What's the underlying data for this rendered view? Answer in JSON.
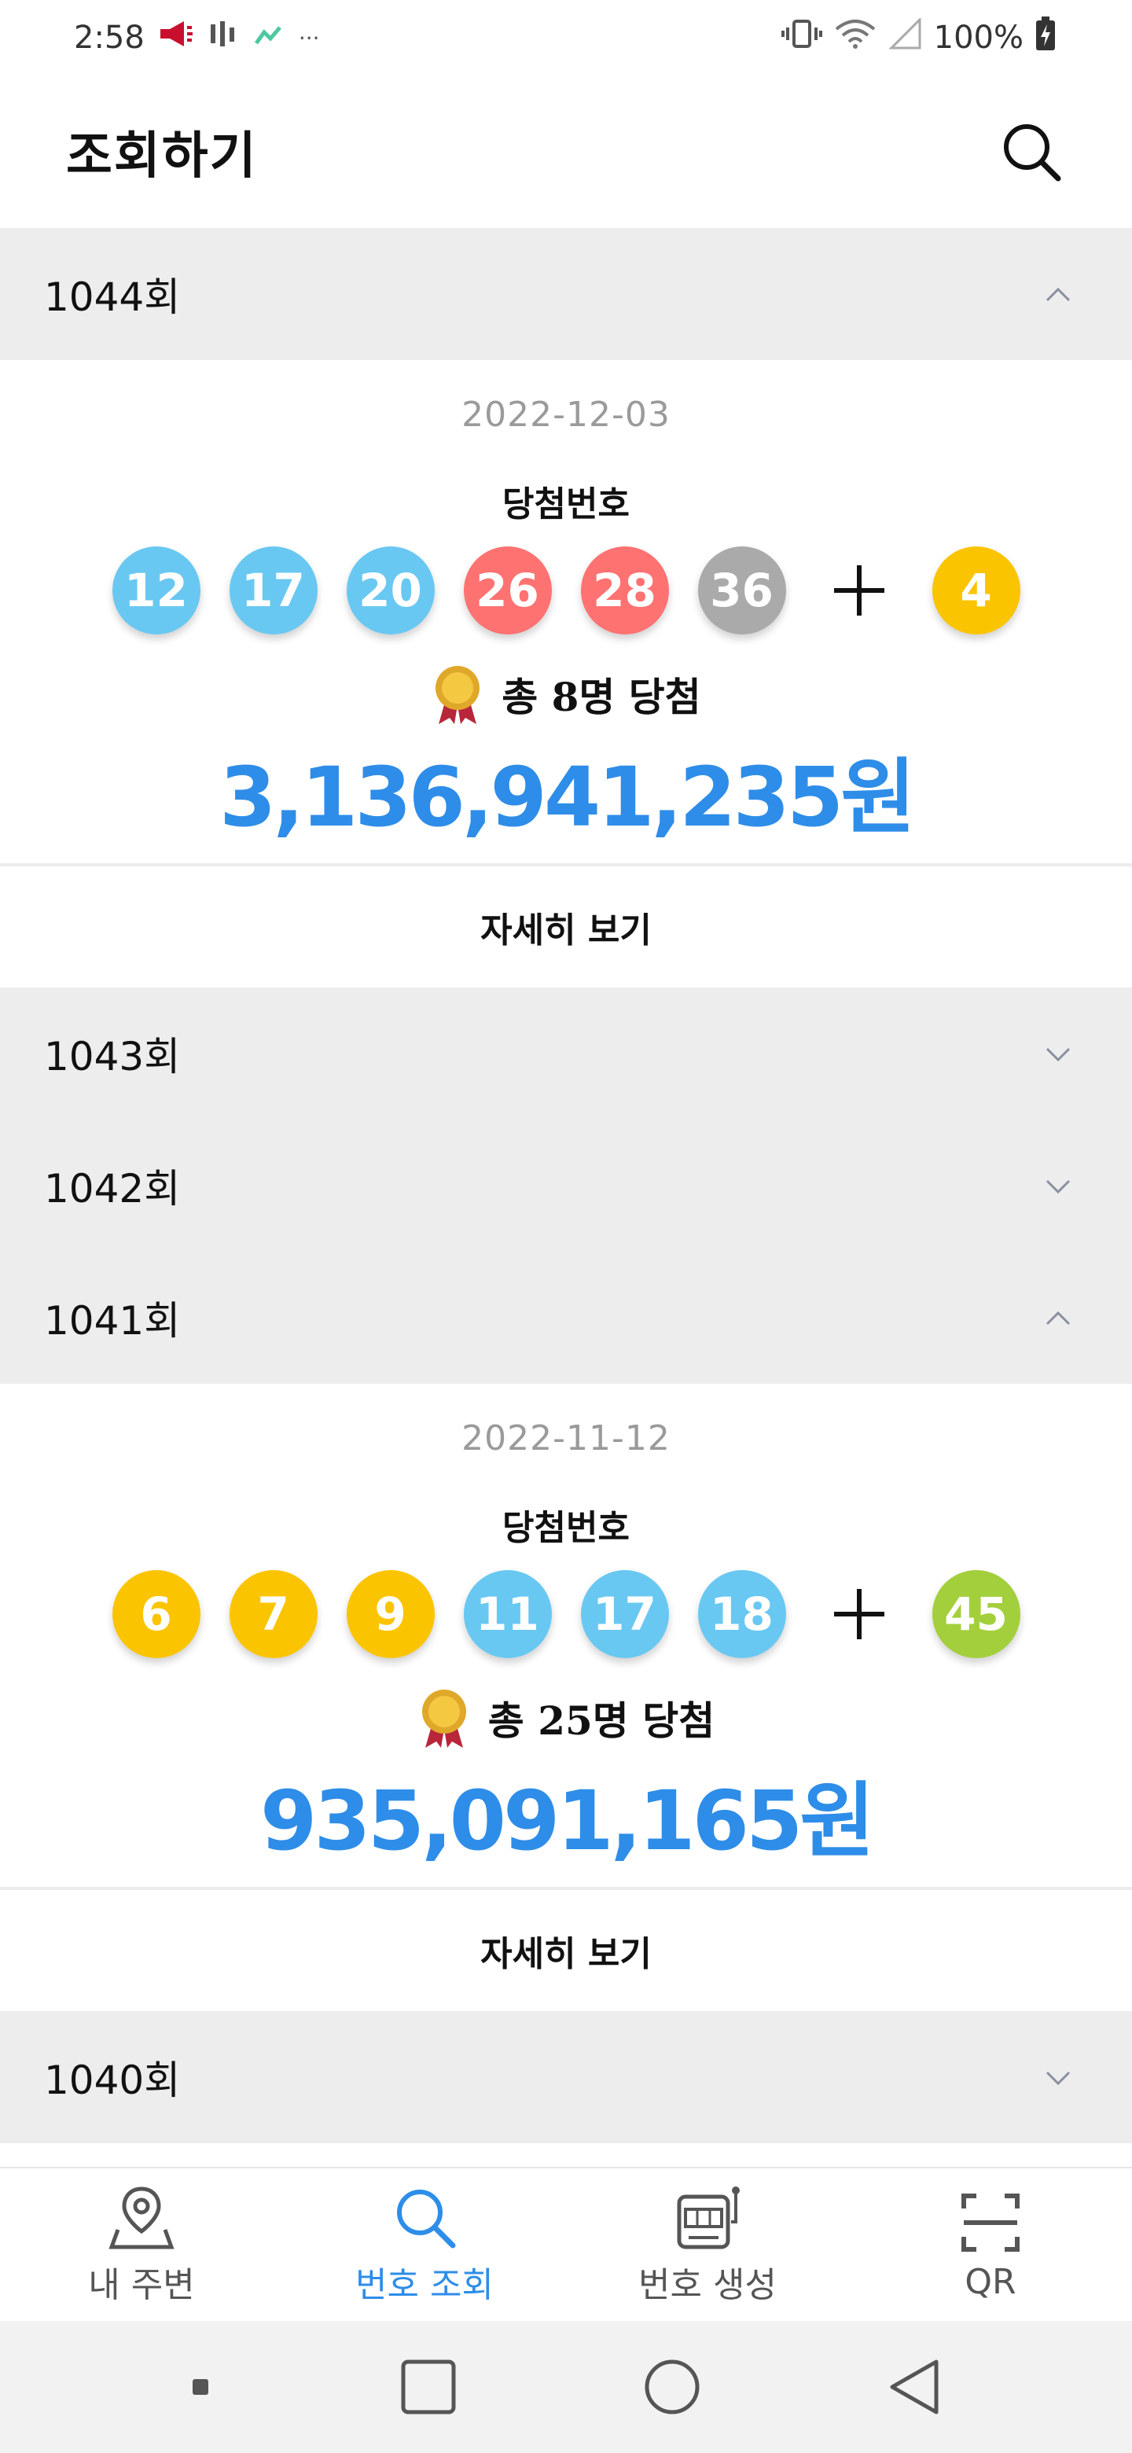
{
  "status_bar": {
    "time": "2:58",
    "battery": "100%"
  },
  "app_bar": {
    "title": "조회하기"
  },
  "rounds": [
    {
      "label": "1044회",
      "expanded": true,
      "date": "2022-12-03",
      "win_label": "당첨번호",
      "numbers": [
        {
          "n": "12",
          "color": "#69c8f2"
        },
        {
          "n": "17",
          "color": "#69c8f2"
        },
        {
          "n": "20",
          "color": "#69c8f2"
        },
        {
          "n": "26",
          "color": "#ff7272"
        },
        {
          "n": "28",
          "color": "#ff7272"
        },
        {
          "n": "36",
          "color": "#aaaaaa"
        }
      ],
      "bonus": {
        "n": "4",
        "color": "#fbc400"
      },
      "winners": "총 8명 당첨",
      "prize": "3,136,941,235원",
      "more": "자세히 보기"
    },
    {
      "label": "1043회",
      "expanded": false
    },
    {
      "label": "1042회",
      "expanded": false
    },
    {
      "label": "1041회",
      "expanded": true,
      "date": "2022-11-12",
      "win_label": "당첨번호",
      "numbers": [
        {
          "n": "6",
          "color": "#fbc400"
        },
        {
          "n": "7",
          "color": "#fbc400"
        },
        {
          "n": "9",
          "color": "#fbc400"
        },
        {
          "n": "11",
          "color": "#69c8f2"
        },
        {
          "n": "17",
          "color": "#69c8f2"
        },
        {
          "n": "18",
          "color": "#69c8f2"
        }
      ],
      "bonus": {
        "n": "45",
        "color": "#a4cf3c"
      },
      "winners": "총 25명 당첨",
      "prize": "935,091,165원",
      "more": "자세히 보기"
    },
    {
      "label": "1040회",
      "expanded": false
    }
  ],
  "bottom_nav": [
    {
      "label": "내 주변",
      "icon": "map-pin-icon",
      "active": false
    },
    {
      "label": "번호 조회",
      "icon": "search-icon",
      "active": true
    },
    {
      "label": "번호 생성",
      "icon": "slot-machine-icon",
      "active": false
    },
    {
      "label": "QR",
      "icon": "qr-scan-icon",
      "active": false
    }
  ],
  "colors": {
    "accent": "#2e8de8",
    "header_bg": "#ededed"
  }
}
